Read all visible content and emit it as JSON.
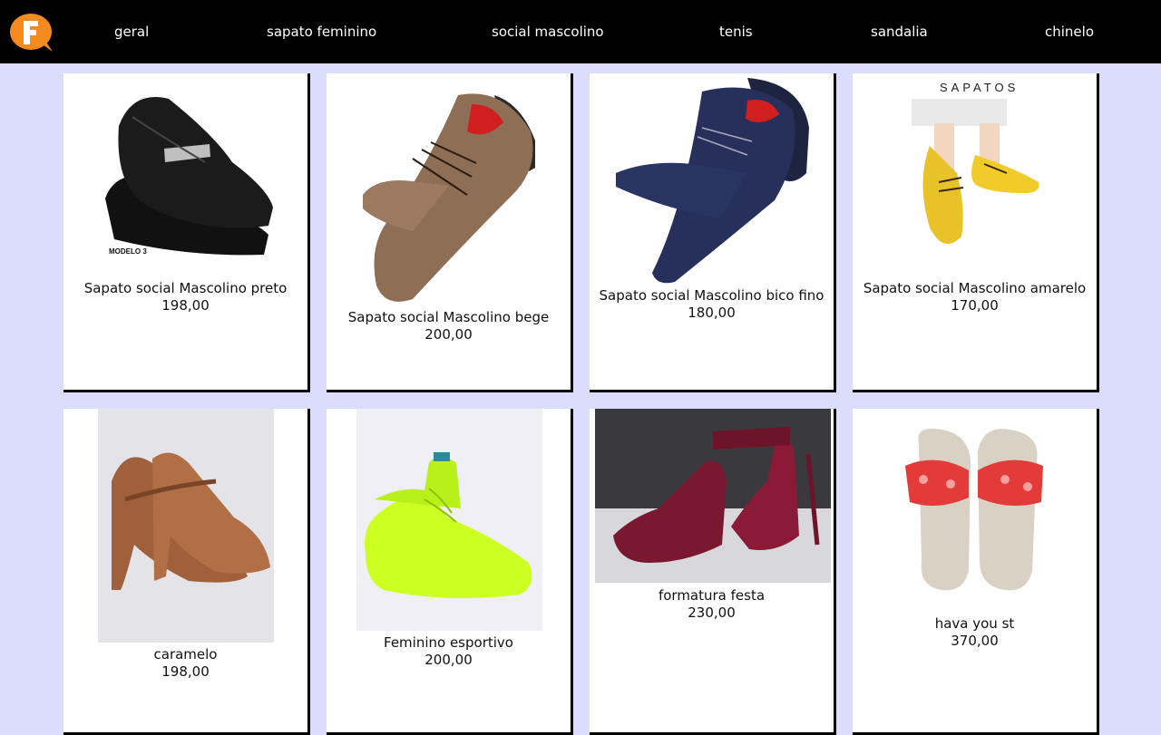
{
  "nav": {
    "items": [
      "geral",
      "sapato feminino",
      "social mascolino",
      "tenis",
      "sandalia",
      "chinelo"
    ]
  },
  "products": [
    {
      "title": "Sapato social Mascolino preto",
      "price": "198,00",
      "image_caption": "MODELO 3"
    },
    {
      "title": "Sapato social Mascolino bege",
      "price": "200,00"
    },
    {
      "title": "Sapato social Mascolino bico fino",
      "price": "180,00"
    },
    {
      "title": "Sapato social Mascolino amarelo",
      "price": "170,00",
      "image_caption": "SAPATOS"
    },
    {
      "title": "caramelo",
      "price": "198,00"
    },
    {
      "title": "Feminino esportivo",
      "price": "200,00"
    },
    {
      "title": "formatura festa",
      "price": "230,00"
    },
    {
      "title": "hava you st",
      "price": "370,00"
    }
  ],
  "colors": {
    "page_bg": "#dcdcff",
    "navbar_bg": "#000000",
    "logo_orange": "#f58a1f"
  }
}
